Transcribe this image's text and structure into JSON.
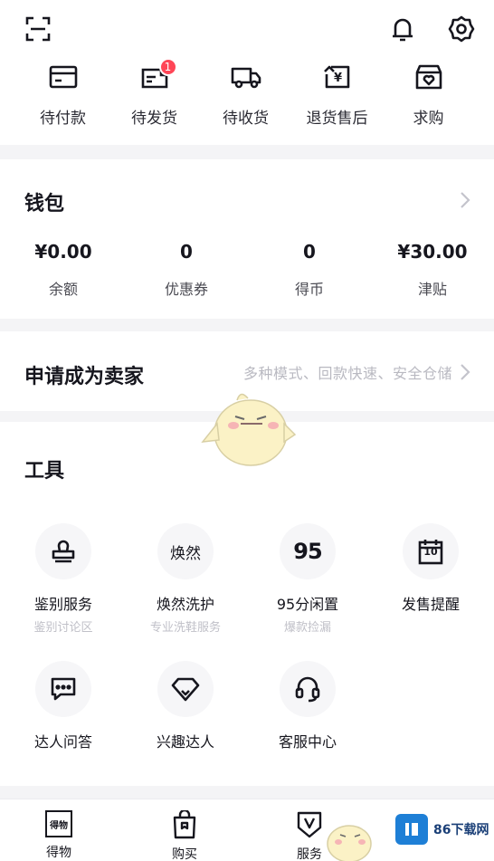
{
  "orders": [
    {
      "label": "待付款",
      "icon": "wallet-card-icon"
    },
    {
      "label": "待发货",
      "icon": "package-out-icon",
      "badge": "1"
    },
    {
      "label": "待收货",
      "icon": "truck-icon"
    },
    {
      "label": "退货售后",
      "icon": "return-yen-icon"
    },
    {
      "label": "求购",
      "icon": "heart-box-icon"
    }
  ],
  "wallet": {
    "title": "钱包",
    "items": [
      {
        "value": "¥0.00",
        "label": "余额"
      },
      {
        "value": "0",
        "label": "优惠券"
      },
      {
        "value": "0",
        "label": "得币"
      },
      {
        "value": "¥30.00",
        "label": "津贴"
      }
    ]
  },
  "seller": {
    "title": "申请成为卖家",
    "subtitle": "多种模式、回款快速、安全仓储"
  },
  "tools": {
    "title": "工具",
    "items": [
      {
        "label": "鉴别服务",
        "sub": "鉴别讨论区",
        "icon": "stamp-icon"
      },
      {
        "label": "焕然洗护",
        "sub": "专业洗鞋服务",
        "icon": "huanran-logo-icon",
        "glyph": "焕然"
      },
      {
        "label": "95分闲置",
        "sub": "爆款捡漏",
        "icon": "95-logo-icon",
        "glyph": "95"
      },
      {
        "label": "发售提醒",
        "sub": "",
        "icon": "calendar-icon",
        "glyph": "10"
      },
      {
        "label": "达人问答",
        "sub": "",
        "icon": "chat-bubble-icon"
      },
      {
        "label": "兴趣达人",
        "sub": "",
        "icon": "diamond-icon"
      },
      {
        "label": "客服中心",
        "sub": "",
        "icon": "headset-icon"
      }
    ]
  },
  "tabbar": [
    {
      "label": "得物",
      "icon": "dewu-logo-icon",
      "glyph": "得物"
    },
    {
      "label": "购买",
      "icon": "shopping-bag-icon"
    },
    {
      "label": "服务",
      "icon": "shield-v-icon"
    }
  ],
  "watermark": {
    "text": "86下载网"
  },
  "colors": {
    "badge": "#ff4657",
    "text": "#16161e",
    "muted": "#b9b9c1",
    "watermark": "#1e7fd6"
  }
}
